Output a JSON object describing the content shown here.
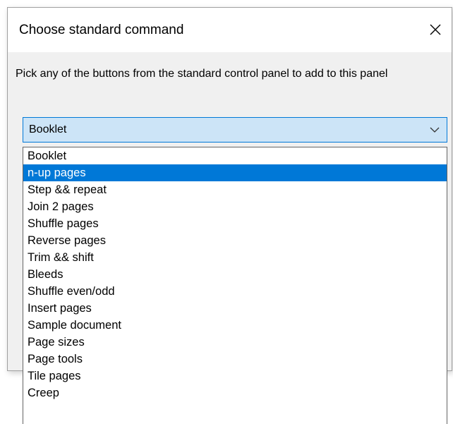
{
  "dialog": {
    "title": "Choose standard command",
    "close_icon": "close-icon",
    "prompt": "Pick any of the buttons from the standard control panel to add to this panel"
  },
  "combo": {
    "value": "Booklet",
    "arrow_icon": "chevron-down-icon",
    "accent": "#0078d7",
    "background": "#cce4f7"
  },
  "list": {
    "selected_index": 1,
    "selected_color": "#0078d7",
    "items": [
      "Booklet",
      "n-up pages",
      "Step && repeat",
      "Join 2 pages",
      "Shuffle pages",
      "Reverse pages",
      "Trim && shift",
      "Bleeds",
      "Shuffle even/odd",
      "Insert pages",
      "Sample document",
      "Page sizes",
      "Page tools",
      "Tile pages",
      "Creep"
    ]
  }
}
